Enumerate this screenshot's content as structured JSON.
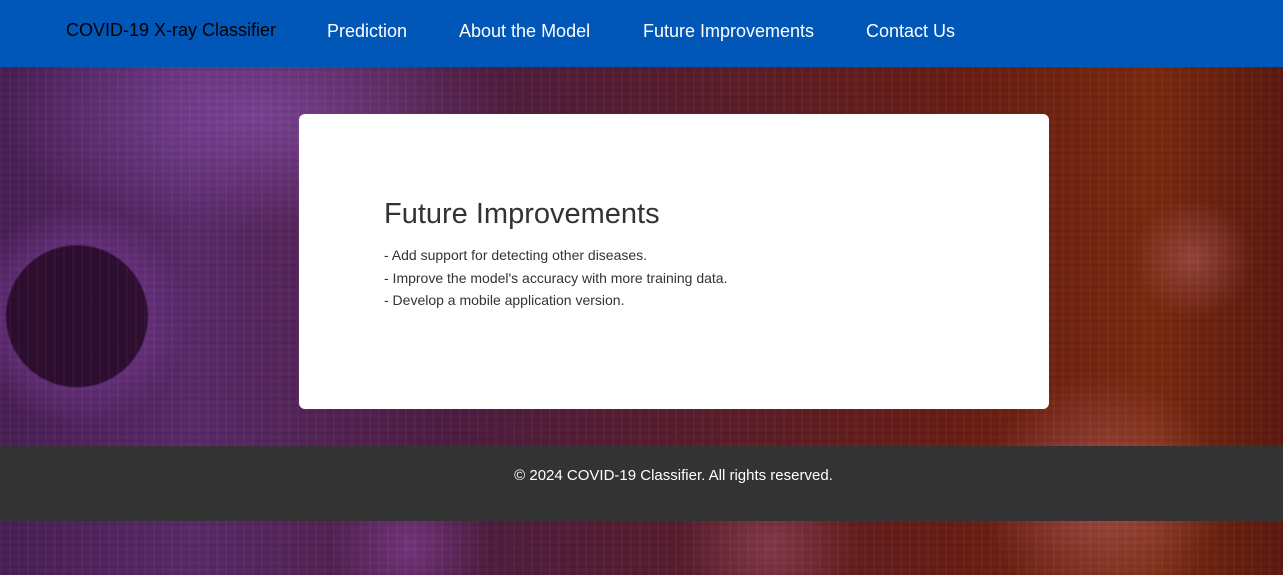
{
  "header": {
    "brand": "COVID-19 X-ray Classifier",
    "nav": [
      {
        "label": "Prediction"
      },
      {
        "label": "About the Model"
      },
      {
        "label": "Future Improvements"
      },
      {
        "label": "Contact Us"
      }
    ]
  },
  "main": {
    "card": {
      "title": "Future Improvements",
      "items": [
        "- Add support for detecting other diseases.",
        "- Improve the model's accuracy with more training data.",
        "- Develop a mobile application version."
      ]
    }
  },
  "footer": {
    "text": "© 2024 COVID-19 Classifier. All rights reserved."
  },
  "colors": {
    "navbar": "#0057b8",
    "footer": "#333333",
    "card": "#ffffff",
    "text": "#333333"
  }
}
